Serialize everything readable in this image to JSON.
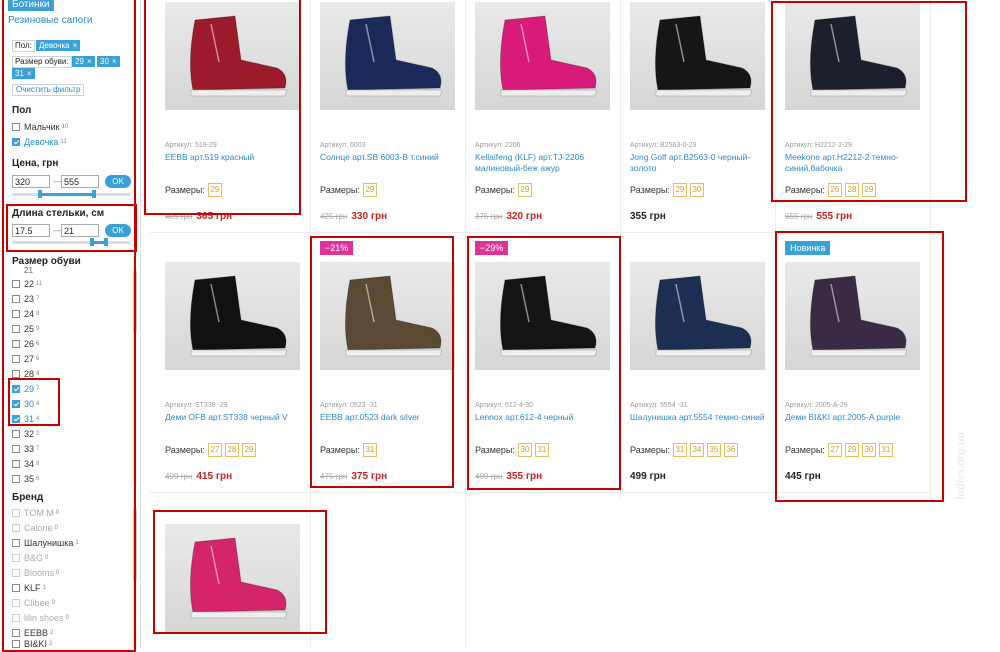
{
  "sidebar": {
    "category_active": "Ботинки",
    "category_link": "Резиновые сапоги",
    "selected_filters": {
      "gender_label": "Пол:",
      "gender_chip": "Девочка",
      "size_label": "Размер обуви:",
      "size_chips": [
        "29",
        "30",
        "31"
      ],
      "remove_icon": "×",
      "clear_label": "Очистить фильтр"
    },
    "gender": {
      "title": "Пол",
      "options": [
        {
          "label": "Мальчик",
          "count": "10",
          "checked": false
        },
        {
          "label": "Девочка",
          "count": "11",
          "checked": true
        }
      ]
    },
    "price": {
      "title": "Цена, грн",
      "from": "320",
      "to": "555",
      "ok_label": "OK"
    },
    "insole": {
      "title": "Длина стельки, см",
      "from": "17.5",
      "to": "21",
      "ok_label": "OK"
    },
    "size": {
      "title": "Размер обуви",
      "partial_top": "21",
      "options": [
        {
          "label": "22",
          "count": "11",
          "checked": false
        },
        {
          "label": "23",
          "count": "7",
          "checked": false
        },
        {
          "label": "24",
          "count": "8",
          "checked": false
        },
        {
          "label": "25",
          "count": "9",
          "checked": false
        },
        {
          "label": "26",
          "count": "6",
          "checked": false
        },
        {
          "label": "27",
          "count": "6",
          "checked": false
        },
        {
          "label": "28",
          "count": "4",
          "checked": false
        },
        {
          "label": "29",
          "count": "7",
          "checked": true
        },
        {
          "label": "30",
          "count": "4",
          "checked": true
        },
        {
          "label": "31",
          "count": "4",
          "checked": true
        },
        {
          "label": "32",
          "count": "2",
          "checked": false
        },
        {
          "label": "33",
          "count": "7",
          "checked": false
        },
        {
          "label": "34",
          "count": "8",
          "checked": false
        },
        {
          "label": "35",
          "count": "6",
          "checked": false
        }
      ]
    },
    "brand": {
      "title": "Бренд",
      "options": [
        {
          "label": "TOM.M",
          "count": "0",
          "muted": true
        },
        {
          "label": "Calorie",
          "count": "0",
          "muted": true
        },
        {
          "label": "Шалунишка",
          "count": "1",
          "muted": false
        },
        {
          "label": "B&G",
          "count": "0",
          "muted": true
        },
        {
          "label": "Blooms",
          "count": "0",
          "muted": true
        },
        {
          "label": "KLF",
          "count": "1",
          "muted": false
        },
        {
          "label": "Clibee",
          "count": "0",
          "muted": true
        },
        {
          "label": "lilin shoes",
          "count": "0",
          "muted": true
        },
        {
          "label": "EEBB",
          "count": "2",
          "muted": false
        },
        {
          "label": "BI&KI",
          "count": "2",
          "muted": false
        }
      ]
    }
  },
  "products": [
    {
      "sku": "Артикул: 519-29",
      "name": "EEBB арт.519 красный",
      "sizes_label": "Размеры:",
      "sizes": [
        "29"
      ],
      "old_price": "405 грн",
      "price": "365 грн",
      "badge": "",
      "color": "#9b1b2a"
    },
    {
      "sku": "Артикул: 6003",
      "name": "Солнце арт.SB 6003-B т.синий",
      "sizes_label": "Размеры:",
      "sizes": [
        "29"
      ],
      "old_price": "425 грн",
      "price": "330 грн",
      "badge": "",
      "color": "#1a2a5a"
    },
    {
      "sku": "Артикул: 2206",
      "name": "Kellaifeng (KLF) арт.TJ-2206 малиновый-беж ажур",
      "sizes_label": "Размеры:",
      "sizes": [
        "29"
      ],
      "old_price": "375 грн",
      "price": "320 грн",
      "badge": "",
      "color": "#d81b78"
    },
    {
      "sku": "Артикул: B2563-0-29",
      "name": "Jong Golf арт.B2563-0 черный-золото",
      "sizes_label": "Размеры:",
      "sizes": [
        "29",
        "30"
      ],
      "old_price": "",
      "price": "355 грн",
      "badge": "",
      "color": "#161616"
    },
    {
      "sku": "Артикул: H2212-2-29",
      "name": "Meekone арт.H2212-2 темно-синий,бабочка",
      "sizes_label": "Размеры:",
      "sizes": [
        "26",
        "28",
        "29"
      ],
      "old_price": "655 грн",
      "price": "555 грн",
      "badge": "",
      "color": "#1c1f2c"
    },
    {
      "sku": "Артикул: ST338 -29",
      "name": "Деми OFB арт.ST338 черный V",
      "sizes_label": "Размеры:",
      "sizes": [
        "27",
        "28",
        "29"
      ],
      "old_price": "499 грн",
      "price": "415 грн",
      "badge": "",
      "color": "#111111"
    },
    {
      "sku": "Артикул: 0523 -31",
      "name": "EEBB арт.0523 dark silver",
      "sizes_label": "Размеры:",
      "sizes": [
        "31"
      ],
      "old_price": "475 грн",
      "price": "375 грн",
      "badge": "−21%",
      "color": "#5a4a34"
    },
    {
      "sku": "Артикул: 612-4-30",
      "name": "Lennox арт.612-4 черный",
      "sizes_label": "Размеры:",
      "sizes": [
        "30",
        "31"
      ],
      "old_price": "499 грн",
      "price": "355 грн",
      "badge": "−29%",
      "color": "#141414"
    },
    {
      "sku": "Артикул: 5554 -31",
      "name": "Шалунишка арт.5554 темно-синий",
      "sizes_label": "Размеры:",
      "sizes": [
        "31",
        "34",
        "35",
        "36"
      ],
      "old_price": "",
      "price": "499 грн",
      "badge": "",
      "color": "#1c2e52"
    },
    {
      "sku": "Артикул: 2005-A-29",
      "name": "Деми BI&KI арт.2005-A purple",
      "sizes_label": "Размеры:",
      "sizes": [
        "27",
        "29",
        "30",
        "31"
      ],
      "old_price": "",
      "price": "445 грн",
      "badge": "Новинка",
      "color": "#3a2a44"
    },
    {
      "sku": "",
      "name": "",
      "sizes_label": "",
      "sizes": [],
      "old_price": "",
      "price": "",
      "badge": "",
      "color": "#d4246a"
    }
  ],
  "colors": {
    "accent": "#3aa0d8",
    "price_red": "#c22222",
    "discount_pink": "#e0339a",
    "new_badge": "#3aa0d8",
    "highlight_box": "#c40000"
  },
  "watermark": "ladies.org.ua"
}
